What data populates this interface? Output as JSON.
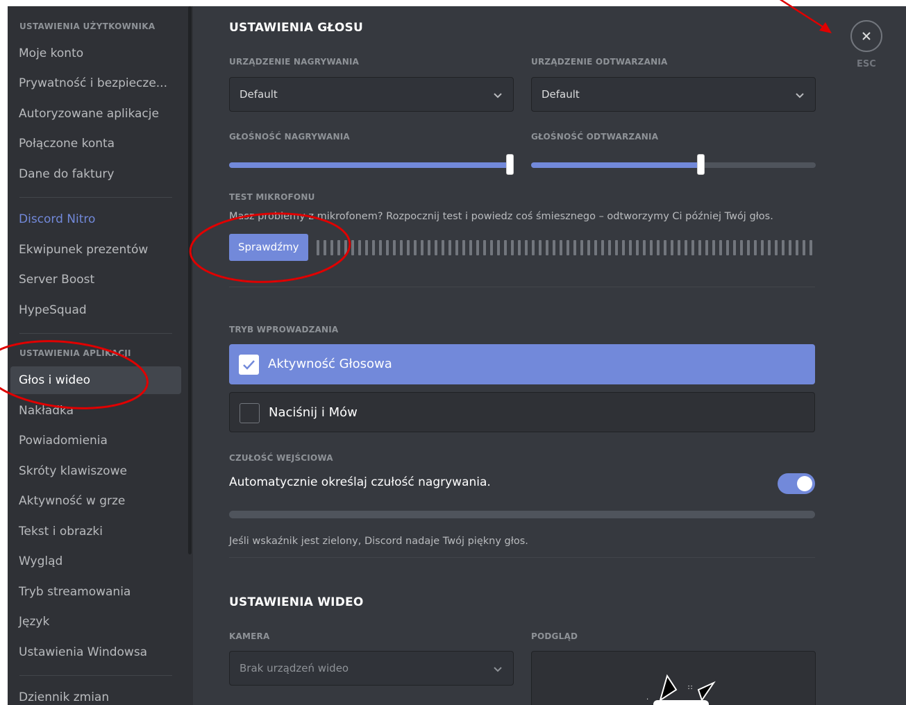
{
  "sidebar": {
    "header_user": "USTAWIENIA UŻYTKOWNIKA",
    "user_items": [
      {
        "label": "Moje konto"
      },
      {
        "label": "Prywatność i bezpiecze..."
      },
      {
        "label": "Autoryzowane aplikacje"
      },
      {
        "label": "Połączone konta"
      },
      {
        "label": "Dane do faktury"
      }
    ],
    "nitro_label": "Discord Nitro",
    "nitro_items": [
      {
        "label": "Ekwipunek prezentów"
      },
      {
        "label": "Server Boost"
      },
      {
        "label": "HypeSquad"
      }
    ],
    "header_app": "USTAWIENIA APLIKACJI",
    "app_items": [
      {
        "label": "Głos i wideo"
      },
      {
        "label": "Nakładka"
      },
      {
        "label": "Powiadomienia"
      },
      {
        "label": "Skróty klawiszowe"
      },
      {
        "label": "Aktywność w grze"
      },
      {
        "label": "Tekst i obrazki"
      },
      {
        "label": "Wygląd"
      },
      {
        "label": "Tryb streamowania"
      },
      {
        "label": "Język"
      },
      {
        "label": "Ustawienia Windowsa"
      }
    ],
    "changelog": "Dziennik zmian"
  },
  "voice": {
    "title": "USTAWIENIA GŁOSU",
    "input_device_label": "URZĄDZENIE NAGRYWANIA",
    "input_device_value": "Default",
    "output_device_label": "URZĄDZENIE ODTWARZANIA",
    "output_device_value": "Default",
    "input_volume_label": "GŁOŚNOŚĆ NAGRYWANIA",
    "input_volume": 1.0,
    "output_volume_label": "GŁOŚNOŚĆ ODTWARZANIA",
    "output_volume": 0.6,
    "mic_test_label": "TEST MIKROFONU",
    "mic_test_desc": "Masz problemy z mikrofonem? Rozpocznij test i powiedz coś śmiesznego – odtworzymy Ci później Twój głos.",
    "mic_test_button": "Sprawdźmy",
    "input_mode_label": "TRYB WPROWADZANIA",
    "mode_voice": "Aktywność Głosowa",
    "mode_ptt": "Naciśnij i Mów",
    "sensitivity_label": "CZUŁOŚĆ WEJŚCIOWA",
    "sensitivity_auto": "Automatycznie określaj czułość nagrywania.",
    "sensitivity_auto_on": true,
    "sensitivity_hint": "Jeśli wskaźnik jest zielony, Discord nadaje Twój piękny głos."
  },
  "video": {
    "title": "USTAWIENIA WIDEO",
    "camera_label": "KAMERA",
    "camera_value": "Brak urządzeń wideo",
    "preview_label": "PODGLĄD"
  },
  "close": {
    "esc_label": "ESC"
  },
  "colors": {
    "accent": "#7289da",
    "annotation": "#e00000"
  }
}
